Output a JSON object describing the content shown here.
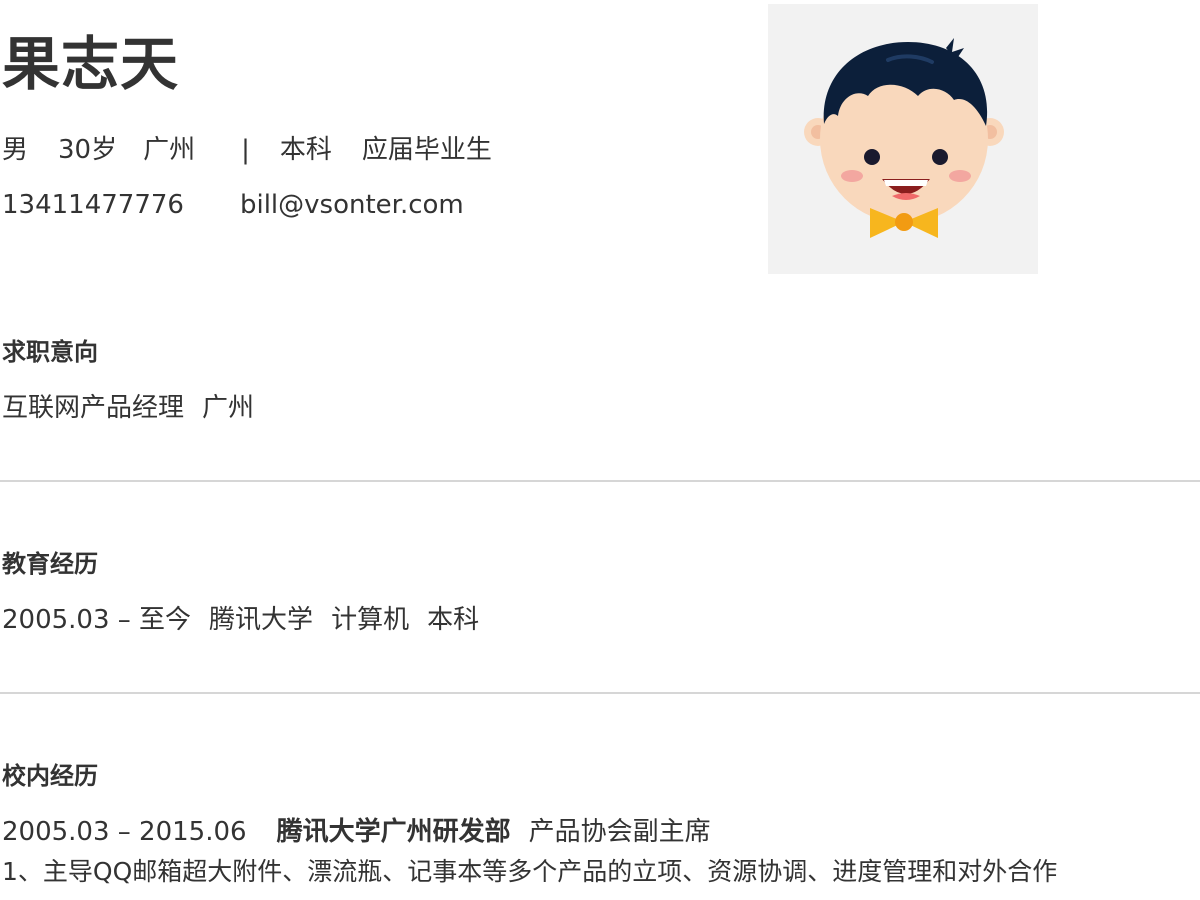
{
  "profile": {
    "name": "果志天",
    "gender": "男",
    "age": "30岁",
    "city": "广州",
    "separator": "|",
    "degree": "本科",
    "status": "应届毕业生",
    "phone": "13411477776",
    "email": "bill@vsonter.com",
    "avatar_icon": "cartoon-boy-avatar"
  },
  "sections": {
    "intent": {
      "title": "求职意向",
      "position": "互联网产品经理",
      "city": "广州"
    },
    "education": {
      "title": "教育经历",
      "period": "2005.03 – 至今",
      "school": "腾讯大学",
      "major": "计算机",
      "degree": "本科"
    },
    "campus": {
      "title": "校内经历",
      "period": "2005.03 – 2015.06",
      "org": "腾讯大学广州研发部",
      "role": "产品协会副主席",
      "detail_1": "1、主导QQ邮箱超大附件、漂流瓶、记事本等多个产品的立项、资源协调、进度管理和对外合作"
    }
  },
  "colors": {
    "text": "#333333",
    "divider": "#d6d6d6",
    "avatar_bg": "#f2f2f2",
    "hair": "#0c1f3a",
    "skin": "#f9d8bc",
    "bowtie": "#f7b61e"
  }
}
